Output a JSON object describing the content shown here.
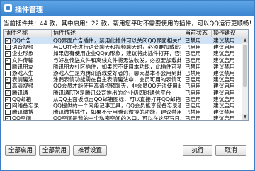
{
  "window": {
    "title": "插件管理"
  },
  "summary": "当前插件共：44 款，其中启用：22 款，帮用您平时不需要使用的插件，可以QQ运行更顺畅！",
  "table": {
    "columns": [
      "插件名称",
      "插件描述",
      "当前状态",
      "操作建议"
    ],
    "rows": [
      {
        "checked": true,
        "name": "QQ广告",
        "desc": "QQ界面广告插件，禁用此插件可以关闭QQ界面相关广告",
        "state": "已禁用",
        "sugg": "建议禁用",
        "selected": true
      },
      {
        "checked": true,
        "name": "语音视频",
        "desc": "与QQ在我进行语音聊天和视频聊天时，必须要加载此插件",
        "state": "已启用",
        "sugg": "建议启用"
      },
      {
        "checked": true,
        "name": "企业形象",
        "desc": "如果您有使用企业QQ的形象，建议将此插件打开，否则将不能看到",
        "state": "已启用",
        "sugg": "建议启用"
      },
      {
        "checked": true,
        "name": "文件传输",
        "desc": "与好友传送文件和离线文件将无法收发，必须要加载此插件",
        "state": "已启用",
        "sugg": "建议启用"
      },
      {
        "checked": false,
        "name": "腾讯朋友",
        "desc": "腾讯朋友社区插件，如果您不使用本功能，此插件可禁用",
        "state": "已禁用",
        "sugg": "建议禁用"
      },
      {
        "checked": false,
        "name": "游戏人生",
        "desc": "游戏人生是为腾讯游戏爱好者的，聊天基本不会用到此插件",
        "state": "已禁用",
        "sugg": "建议禁用"
      },
      {
        "checked": true,
        "name": "表情魔法",
        "desc": "涂鸦表情功能需在自主表情魔法中，会员可用的表情可以便捷",
        "state": "已启用",
        "sugg": "建议启用"
      },
      {
        "checked": true,
        "name": "高清视频",
        "desc": "QQ会员才能使用高清视频聊天，非会员QQ无法使用此插件",
        "state": "已启用",
        "sugg": "建议启用"
      },
      {
        "checked": true,
        "name": "腾讯通",
        "desc": "腾讯通RTX是腾讯公司推出的企业级即时通信平台",
        "state": "已启用",
        "sugg": "建议启用"
      },
      {
        "checked": true,
        "name": "QQ邮箱",
        "desc": "从QQ主面板点击QQ邮箱图标，可以直接打开QQ邮箱并自动登录",
        "state": "已启用",
        "sugg": "建议启用"
      },
      {
        "checked": true,
        "name": "网络备忘录",
        "desc": "QQ提供的一个网络记事工具，QQ会员能享受备忘录漫游",
        "state": "已启用",
        "sugg": "建议启用"
      },
      {
        "checked": false,
        "name": "腾讯微博",
        "desc": "腾讯微博插件，如果不使用腾讯微博的功能，建议禁用",
        "state": "已禁用",
        "sugg": "建议禁用"
      },
      {
        "checked": true,
        "name": "QQ空间",
        "desc": "QQ空间是我的一个私密空间的入口，可以在这里写日志等",
        "state": "已启用",
        "sugg": "建议启用"
      },
      {
        "checked": false,
        "name": "网络硬盘",
        "desc": "网络硬盘提供文件的储存、访问、共享、备份和群共享等功能",
        "state": "已禁用",
        "sugg": "建议禁用"
      }
    ]
  },
  "buttons": {
    "enable_all": "全部启用",
    "disable_all": "全部禁用",
    "recommended": "推荐设置",
    "execute": "执行",
    "cancel": "取消"
  }
}
